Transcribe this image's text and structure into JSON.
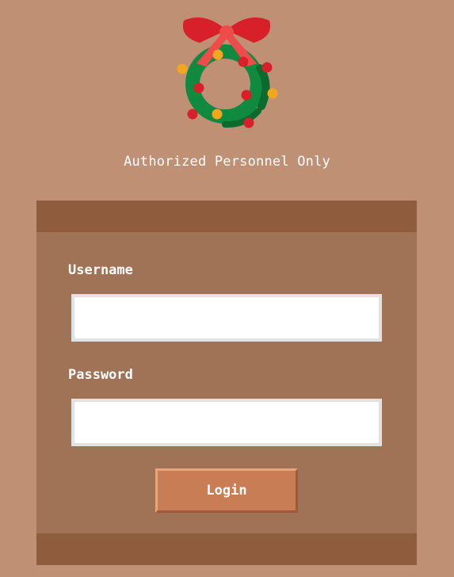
{
  "header": {
    "logo_icon": "christmas-wreath-icon",
    "subtitle": "Authorized Personnel Only"
  },
  "login_form": {
    "username_label": "Username",
    "username_value": "",
    "password_label": "Password",
    "password_value": "",
    "login_label": "Login"
  },
  "colors": {
    "background": "#c09075",
    "panel": "#a17356",
    "panel_band": "#8f5c3e",
    "button": "#c97d55",
    "wreath_green": "#0f8a3e",
    "bow_red": "#d8202a",
    "ornament_yellow": "#f4a61d"
  }
}
